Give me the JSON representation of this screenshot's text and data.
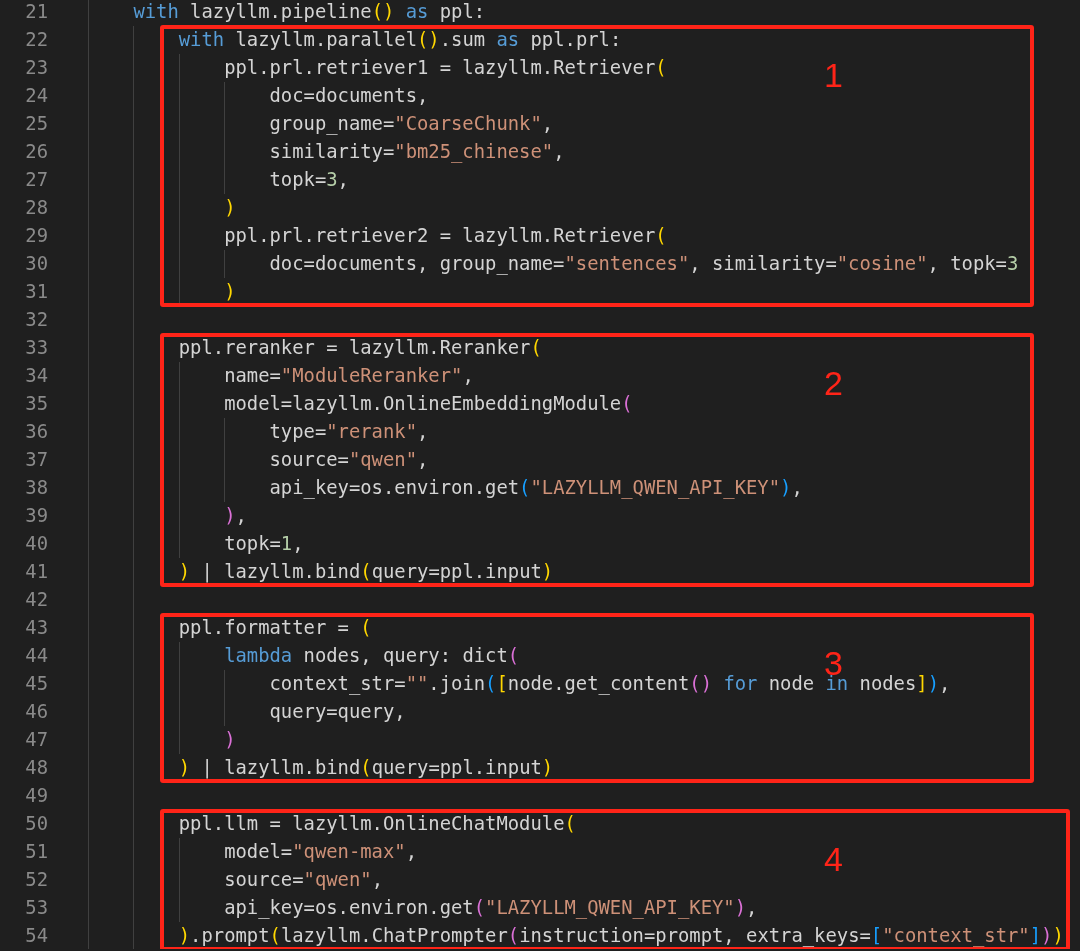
{
  "editor": {
    "segments": [
      {
        "lines": [
          {
            "number": "21",
            "tokens": [
              {
                "kind": "keyword",
                "text": "    with"
              },
              {
                "kind": "plain",
                "text": " lazyllm.pipeline"
              },
              {
                "kind": "bracket1",
                "text": "()"
              },
              {
                "kind": "keyword",
                "text": " as"
              },
              {
                "kind": "plain",
                "text": " ppl:"
              }
            ]
          }
        ]
      },
      {
        "annotation": {
          "label": "1"
        },
        "lines": [
          {
            "number": "22",
            "tokens": [
              {
                "kind": "keyword",
                "text": "        with"
              },
              {
                "kind": "plain",
                "text": " lazyllm.parallel"
              },
              {
                "kind": "bracket1",
                "text": "()"
              },
              {
                "kind": "plain",
                "text": ".sum "
              },
              {
                "kind": "keyword",
                "text": "as"
              },
              {
                "kind": "plain",
                "text": " ppl.prl:"
              }
            ]
          },
          {
            "number": "23",
            "tokens": [
              {
                "kind": "plain",
                "text": "            ppl.prl.retriever1 = lazyllm.Retriever"
              },
              {
                "kind": "bracket1",
                "text": "("
              }
            ]
          },
          {
            "number": "24",
            "tokens": [
              {
                "kind": "plain",
                "text": "                doc=documents,"
              }
            ]
          },
          {
            "number": "25",
            "tokens": [
              {
                "kind": "plain",
                "text": "                group_name="
              },
              {
                "kind": "string",
                "text": "\"CoarseChunk\""
              },
              {
                "kind": "plain",
                "text": ","
              }
            ]
          },
          {
            "number": "26",
            "tokens": [
              {
                "kind": "plain",
                "text": "                similarity="
              },
              {
                "kind": "string",
                "text": "\"bm25_chinese\""
              },
              {
                "kind": "plain",
                "text": ","
              }
            ]
          },
          {
            "number": "27",
            "tokens": [
              {
                "kind": "plain",
                "text": "                topk="
              },
              {
                "kind": "number",
                "text": "3"
              },
              {
                "kind": "plain",
                "text": ","
              }
            ]
          },
          {
            "number": "28",
            "tokens": [
              {
                "kind": "bracket1",
                "text": "            )"
              }
            ]
          },
          {
            "number": "29",
            "tokens": [
              {
                "kind": "plain",
                "text": "            ppl.prl.retriever2 = lazyllm.Retriever"
              },
              {
                "kind": "bracket1",
                "text": "("
              }
            ]
          },
          {
            "number": "30",
            "tokens": [
              {
                "kind": "plain",
                "text": "                doc=documents, group_name="
              },
              {
                "kind": "string",
                "text": "\"sentences\""
              },
              {
                "kind": "plain",
                "text": ", similarity="
              },
              {
                "kind": "string",
                "text": "\"cosine\""
              },
              {
                "kind": "plain",
                "text": ", topk="
              },
              {
                "kind": "number",
                "text": "3"
              }
            ]
          },
          {
            "number": "31",
            "tokens": [
              {
                "kind": "bracket1",
                "text": "            )"
              }
            ]
          }
        ]
      },
      {
        "lines": [
          {
            "number": "32"
          }
        ]
      },
      {
        "annotation": {
          "label": "2"
        },
        "lines": [
          {
            "number": "33",
            "tokens": [
              {
                "kind": "plain",
                "text": "        ppl.reranker = lazyllm.Reranker"
              },
              {
                "kind": "bracket1",
                "text": "("
              }
            ]
          },
          {
            "number": "34",
            "tokens": [
              {
                "kind": "plain",
                "text": "            name="
              },
              {
                "kind": "string",
                "text": "\"ModuleReranker\""
              },
              {
                "kind": "plain",
                "text": ","
              }
            ]
          },
          {
            "number": "35",
            "tokens": [
              {
                "kind": "plain",
                "text": "            model=lazyllm.OnlineEmbeddingModule"
              },
              {
                "kind": "bracket2",
                "text": "("
              }
            ]
          },
          {
            "number": "36",
            "tokens": [
              {
                "kind": "plain",
                "text": "                type="
              },
              {
                "kind": "string",
                "text": "\"rerank\""
              },
              {
                "kind": "plain",
                "text": ","
              }
            ]
          },
          {
            "number": "37",
            "tokens": [
              {
                "kind": "plain",
                "text": "                source="
              },
              {
                "kind": "string",
                "text": "\"qwen\""
              },
              {
                "kind": "plain",
                "text": ","
              }
            ]
          },
          {
            "number": "38",
            "tokens": [
              {
                "kind": "plain",
                "text": "                api_key=os.environ.get"
              },
              {
                "kind": "bracket3",
                "text": "("
              },
              {
                "kind": "string",
                "text": "\"LAZYLLM_QWEN_API_KEY\""
              },
              {
                "kind": "bracket3",
                "text": ")"
              },
              {
                "kind": "plain",
                "text": ","
              }
            ]
          },
          {
            "number": "39",
            "tokens": [
              {
                "kind": "bracket2",
                "text": "            )"
              },
              {
                "kind": "plain",
                "text": ","
              }
            ]
          },
          {
            "number": "40",
            "tokens": [
              {
                "kind": "plain",
                "text": "            topk="
              },
              {
                "kind": "number",
                "text": "1"
              },
              {
                "kind": "plain",
                "text": ","
              }
            ]
          },
          {
            "number": "41",
            "tokens": [
              {
                "kind": "bracket1",
                "text": "        )"
              },
              {
                "kind": "plain",
                "text": " | lazyllm.bind"
              },
              {
                "kind": "bracket1",
                "text": "("
              },
              {
                "kind": "plain",
                "text": "query=ppl.input"
              },
              {
                "kind": "bracket1",
                "text": ")"
              }
            ]
          }
        ]
      },
      {
        "lines": [
          {
            "number": "42"
          }
        ]
      },
      {
        "annotation": {
          "label": "3"
        },
        "lines": [
          {
            "number": "43",
            "tokens": [
              {
                "kind": "plain",
                "text": "        ppl.formatter = "
              },
              {
                "kind": "bracket1",
                "text": "("
              }
            ]
          },
          {
            "number": "44",
            "tokens": [
              {
                "kind": "keyword",
                "text": "            lambda"
              },
              {
                "kind": "plain",
                "text": " nodes, query: dict"
              },
              {
                "kind": "bracket2",
                "text": "("
              }
            ]
          },
          {
            "number": "45",
            "tokens": [
              {
                "kind": "plain",
                "text": "                context_str="
              },
              {
                "kind": "string",
                "text": "\"\""
              },
              {
                "kind": "plain",
                "text": ".join"
              },
              {
                "kind": "bracket3",
                "text": "("
              },
              {
                "kind": "bracket1",
                "text": "["
              },
              {
                "kind": "plain",
                "text": "node.get_content"
              },
              {
                "kind": "bracket2",
                "text": "()"
              },
              {
                "kind": "keyword",
                "text": " for"
              },
              {
                "kind": "plain",
                "text": " node "
              },
              {
                "kind": "keyword",
                "text": "in"
              },
              {
                "kind": "plain",
                "text": " nodes"
              },
              {
                "kind": "bracket1",
                "text": "]"
              },
              {
                "kind": "bracket3",
                "text": ")"
              },
              {
                "kind": "plain",
                "text": ","
              }
            ]
          },
          {
            "number": "46",
            "tokens": [
              {
                "kind": "plain",
                "text": "                query=query,"
              }
            ]
          },
          {
            "number": "47",
            "tokens": [
              {
                "kind": "bracket2",
                "text": "            )"
              }
            ]
          },
          {
            "number": "48",
            "tokens": [
              {
                "kind": "bracket1",
                "text": "        )"
              },
              {
                "kind": "plain",
                "text": " | lazyllm.bind"
              },
              {
                "kind": "bracket1",
                "text": "("
              },
              {
                "kind": "plain",
                "text": "query=ppl.input"
              },
              {
                "kind": "bracket1",
                "text": ")"
              }
            ]
          }
        ]
      },
      {
        "lines": [
          {
            "number": "49"
          }
        ]
      },
      {
        "annotation": {
          "label": "4"
        },
        "lines": [
          {
            "number": "50",
            "tokens": [
              {
                "kind": "plain",
                "text": "        ppl.llm = lazyllm.OnlineChatModule"
              },
              {
                "kind": "bracket1",
                "text": "("
              }
            ]
          },
          {
            "number": "51",
            "tokens": [
              {
                "kind": "plain",
                "text": "            model="
              },
              {
                "kind": "string",
                "text": "\"qwen-max\""
              },
              {
                "kind": "plain",
                "text": ","
              }
            ]
          },
          {
            "number": "52",
            "tokens": [
              {
                "kind": "plain",
                "text": "            source="
              },
              {
                "kind": "string",
                "text": "\"qwen\""
              },
              {
                "kind": "plain",
                "text": ","
              }
            ]
          },
          {
            "number": "53",
            "tokens": [
              {
                "kind": "plain",
                "text": "            api_key=os.environ.get"
              },
              {
                "kind": "bracket2",
                "text": "("
              },
              {
                "kind": "string",
                "text": "\"LAZYLLM_QWEN_API_KEY\""
              },
              {
                "kind": "bracket2",
                "text": ")"
              },
              {
                "kind": "plain",
                "text": ","
              }
            ]
          },
          {
            "number": "54",
            "tokens": [
              {
                "kind": "bracket1",
                "text": "        )"
              },
              {
                "kind": "plain",
                "text": ".prompt"
              },
              {
                "kind": "bracket1",
                "text": "("
              },
              {
                "kind": "plain",
                "text": "lazyllm.ChatPrompter"
              },
              {
                "kind": "bracket2",
                "text": "("
              },
              {
                "kind": "plain",
                "text": "instruction=prompt, extra_keys="
              },
              {
                "kind": "bracket3",
                "text": "["
              },
              {
                "kind": "string",
                "text": "\"context_str\""
              },
              {
                "kind": "bracket3",
                "text": "]"
              },
              {
                "kind": "bracket2",
                "text": ")"
              },
              {
                "kind": "bracket1",
                "text": ")"
              }
            ]
          }
        ]
      }
    ]
  }
}
